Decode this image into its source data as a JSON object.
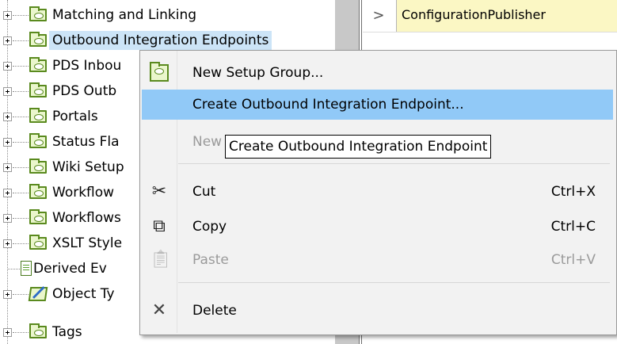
{
  "tree": {
    "items": [
      {
        "label": "Matching and Linking",
        "icon": "folder-icon"
      },
      {
        "label": "Outbound Integration Endpoints",
        "icon": "folder-icon",
        "selected": true
      },
      {
        "label": "PDS Inbou",
        "icon": "folder-icon"
      },
      {
        "label": "PDS Outb",
        "icon": "folder-icon"
      },
      {
        "label": "Portals",
        "icon": "folder-icon"
      },
      {
        "label": "Status Fla",
        "icon": "folder-icon"
      },
      {
        "label": "Wiki Setup",
        "icon": "folder-icon"
      },
      {
        "label": "Workflow",
        "icon": "folder-icon"
      },
      {
        "label": "Workflows",
        "icon": "folder-icon"
      },
      {
        "label": "XSLT Style",
        "icon": "folder-icon"
      },
      {
        "label": "Derived Ev",
        "icon": "document-icon"
      },
      {
        "label": "Object Ty",
        "icon": "object-type-icon"
      },
      {
        "label": "Tags",
        "icon": "folder-icon"
      }
    ]
  },
  "right_panel": {
    "rows": [
      {
        "arrow": ">",
        "value": "ConfigurationPublisher"
      }
    ]
  },
  "context_menu": {
    "items": [
      {
        "label": "New Setup Group...",
        "icon": "folder-icon",
        "shortcut": ""
      },
      {
        "label": "Create Outbound Integration Endpoint...",
        "icon": "",
        "shortcut": "",
        "hover": true
      },
      {
        "label": "New",
        "icon": "",
        "shortcut": ""
      },
      {
        "label": "Cut",
        "icon": "scissors-icon",
        "shortcut": "Ctrl+X"
      },
      {
        "label": "Copy",
        "icon": "copy-icon",
        "shortcut": "Ctrl+C"
      },
      {
        "label": "Paste",
        "icon": "paste-icon",
        "shortcut": "Ctrl+V",
        "disabled": true
      },
      {
        "label": "Delete",
        "icon": "delete-icon",
        "shortcut": ""
      }
    ]
  },
  "tooltip": {
    "text": "Create Outbound Integration Endpoint"
  },
  "colors": {
    "hover": "#91c9f7",
    "selection": "#cce4f7",
    "folder": "#5a8a1e",
    "value_cell": "#fbf7c4"
  }
}
